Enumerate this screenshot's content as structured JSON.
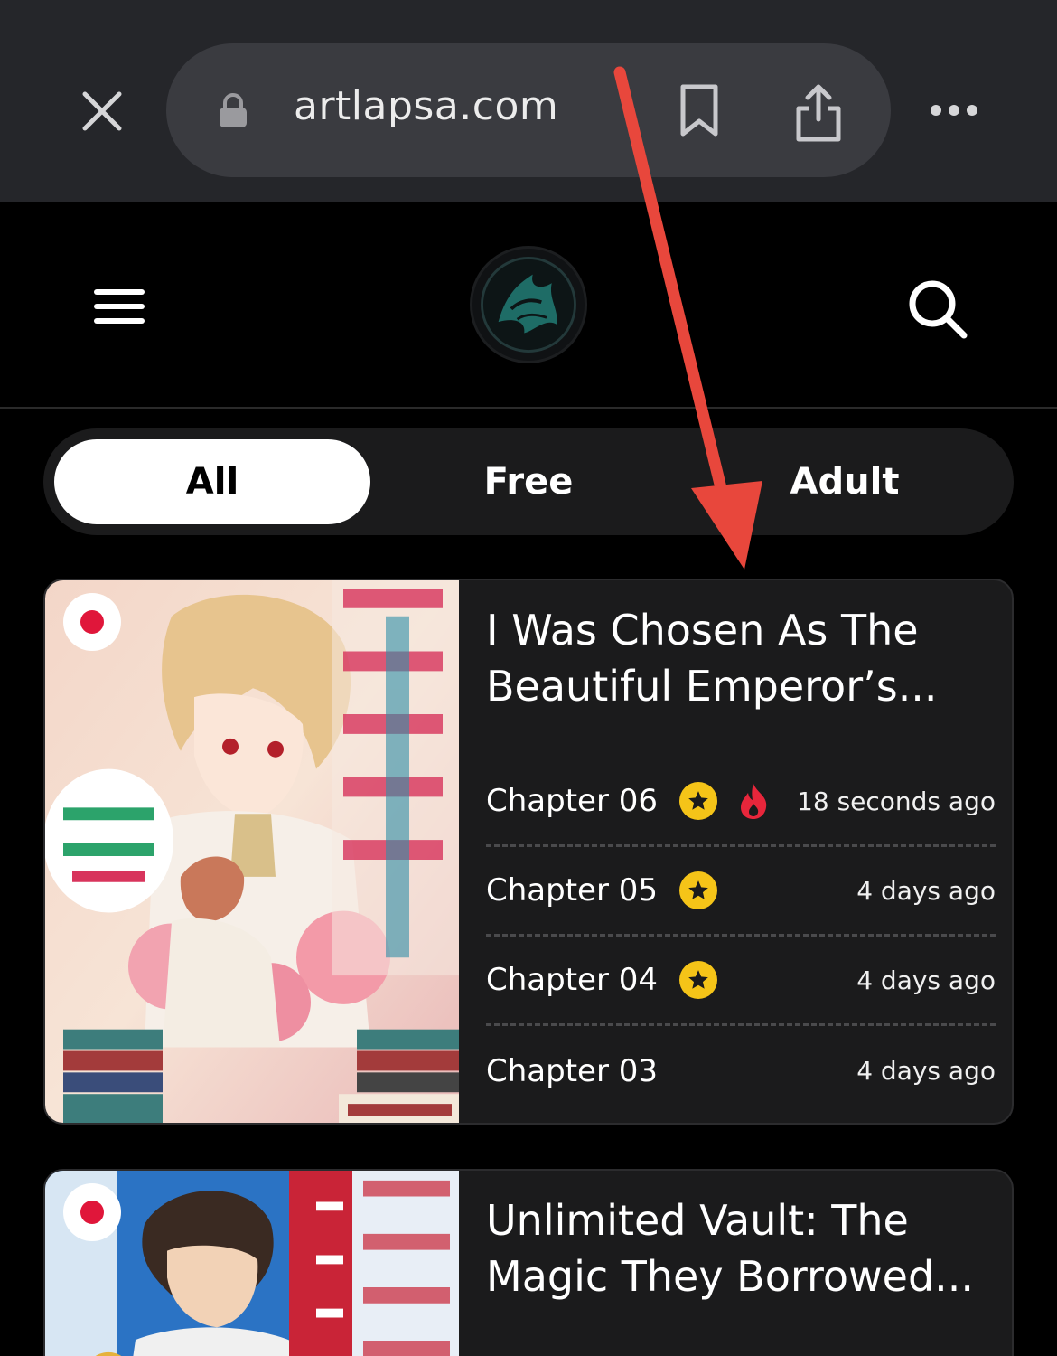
{
  "browser": {
    "url": "artlapsa.com",
    "icons": {
      "close": "close-icon",
      "lock": "lock-icon",
      "bookmark": "bookmark-icon",
      "share": "share-icon",
      "more": "more-icon"
    }
  },
  "header": {
    "icons": {
      "menu": "menu-icon",
      "logo": "site-logo",
      "search": "search-icon"
    }
  },
  "tabs": [
    {
      "label": "All",
      "active": true
    },
    {
      "label": "Free",
      "active": false
    },
    {
      "label": "Adult",
      "active": false
    }
  ],
  "series": [
    {
      "title": "I Was Chosen As The Beautiful Emperor’s...",
      "chapters": [
        {
          "label": "Chapter 06",
          "time": "18 seconds ago",
          "premium": true,
          "hot": true
        },
        {
          "label": "Chapter 05",
          "time": "4 days ago",
          "premium": true,
          "hot": false
        },
        {
          "label": "Chapter 04",
          "time": "4 days ago",
          "premium": true,
          "hot": false
        },
        {
          "label": "Chapter 03",
          "time": "4 days ago",
          "premium": false,
          "hot": false
        }
      ]
    },
    {
      "title": "Unlimited Vault: The Magic They Borrowed..."
    }
  ],
  "colors": {
    "browser_bar": "#25262a",
    "url_pill": "#3a3b40",
    "card_bg": "#1b1b1c",
    "star_badge": "#f5c418",
    "fire": "#e8263b",
    "annotation_arrow": "#e8473c"
  }
}
